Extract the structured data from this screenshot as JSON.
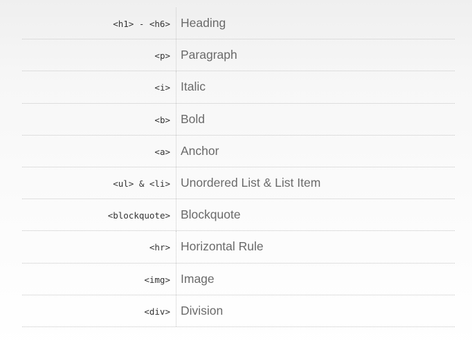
{
  "rows": [
    {
      "tag": "<h1> - <h6>",
      "description": "Heading"
    },
    {
      "tag": "<p>",
      "description": "Paragraph"
    },
    {
      "tag": "<i>",
      "description": "Italic"
    },
    {
      "tag": "<b>",
      "description": "Bold"
    },
    {
      "tag": "<a>",
      "description": "Anchor"
    },
    {
      "tag": "<ul> & <li>",
      "description": "Unordered List & List Item"
    },
    {
      "tag": "<blockquote>",
      "description": "Blockquote"
    },
    {
      "tag": "<hr>",
      "description": "Horizontal Rule"
    },
    {
      "tag": "<img>",
      "description": "Image"
    },
    {
      "tag": "<div>",
      "description": "Division"
    }
  ]
}
